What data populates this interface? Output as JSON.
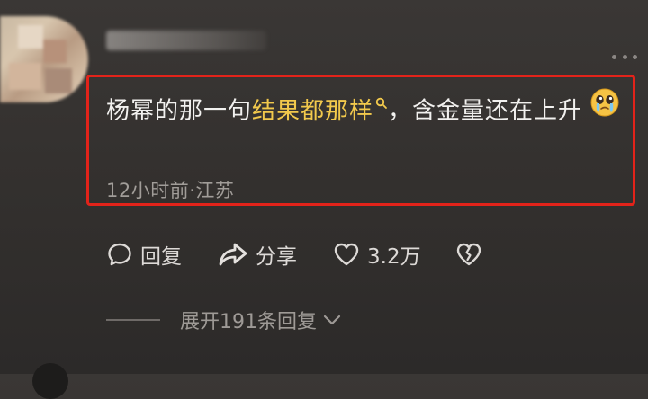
{
  "comment": {
    "text_before": "杨幂的那一句",
    "keyword": "结果都那样",
    "text_after": "，含金量还在上升",
    "time_location": "12小时前·江苏"
  },
  "actions": {
    "reply_label": "回复",
    "share_label": "分享",
    "like_count": "3.2万"
  },
  "replies": {
    "expand_label": "展开191条回复"
  },
  "colors": {
    "highlight_border": "#e2231a",
    "keyword": "#f2c94c",
    "background": "#33302e"
  },
  "icons": [
    "more-icon",
    "search-icon",
    "crying-emoji-icon",
    "reply-icon",
    "share-icon",
    "heart-icon",
    "broken-heart-icon",
    "chevron-down-icon"
  ]
}
